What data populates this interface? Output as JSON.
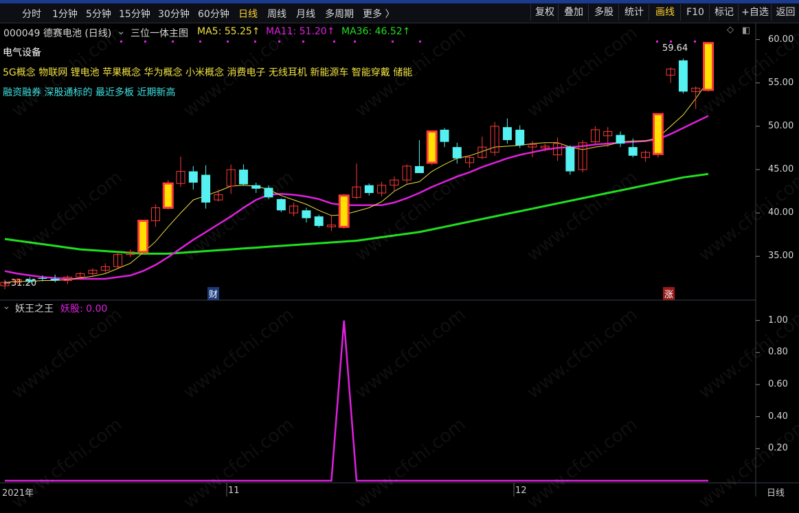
{
  "toolbar": {
    "periods": [
      "分时",
      "1分钟",
      "5分钟",
      "15分钟",
      "30分钟",
      "60分钟",
      "日线",
      "周线",
      "月线",
      "多周期",
      "更多 〉"
    ],
    "active_period": "日线",
    "right_buttons": [
      "复权",
      "叠加",
      "多股",
      "统计",
      "画线",
      "F10",
      "标记",
      "+自选",
      "返回"
    ],
    "active_right": "画线"
  },
  "stock": {
    "code_name": "000049 德赛电池 (日线)",
    "indicator_name": "三位一体主图",
    "ma5_label": "MA5: 55.25↑",
    "ma11_label": "MA11: 51.20↑",
    "ma36_label": "MA36: 46.52↑",
    "industry": "电气设备",
    "concepts": "5G概念 物联网 锂电池 苹果概念 华为概念 小米概念 消费电子 无线耳机 新能源车 智能穿戴 储能",
    "tags": "融资融券 深股通标的 最近多板 近期新高",
    "high_label": "59.64",
    "low_label": "←31.20",
    "marker_cai": "财",
    "marker_zhang": "涨"
  },
  "sub_indicator": {
    "name": "妖王之王",
    "series_label": "妖股: 0.00"
  },
  "colors": {
    "up": "#ff3a3a",
    "down": "#55f0f0",
    "ma5": "#f0e040",
    "ma11": "#e020e0",
    "ma36": "#20e020",
    "limit_up_fill": "#ffe000",
    "yaogu": "#e020e0"
  },
  "chart_data": [
    {
      "type": "candlestick",
      "title": "000049 德赛电池 (日线)",
      "ylim": [
        30.5,
        61
      ],
      "y_ticks": [
        "60.00",
        "55.00",
        "50.00",
        "45.00",
        "40.00",
        "35.00"
      ],
      "x_labels": [
        "2021年",
        "11",
        "12",
        "日线"
      ],
      "candles": [
        {
          "o": 31.6,
          "h": 32.3,
          "l": 31.2,
          "c": 32.0
        },
        {
          "o": 32.0,
          "h": 32.5,
          "l": 31.8,
          "c": 32.3
        },
        {
          "o": 32.3,
          "h": 32.6,
          "l": 31.9,
          "c": 32.1
        },
        {
          "o": 32.5,
          "h": 32.8,
          "l": 32.1,
          "c": 32.4
        },
        {
          "o": 32.4,
          "h": 32.9,
          "l": 32.0,
          "c": 32.2
        },
        {
          "o": 32.2,
          "h": 32.8,
          "l": 31.8,
          "c": 32.6
        },
        {
          "o": 32.6,
          "h": 33.2,
          "l": 32.3,
          "c": 33.0
        },
        {
          "o": 33.0,
          "h": 33.6,
          "l": 32.7,
          "c": 33.4
        },
        {
          "o": 33.4,
          "h": 34.2,
          "l": 33.1,
          "c": 33.8
        },
        {
          "o": 33.8,
          "h": 35.5,
          "l": 33.6,
          "c": 35.2
        },
        {
          "o": 35.2,
          "h": 35.8,
          "l": 34.9,
          "c": 35.5
        },
        {
          "o": 35.5,
          "h": 39.2,
          "l": 35.3,
          "c": 39.1,
          "limit": true
        },
        {
          "o": 39.1,
          "h": 41.0,
          "l": 38.4,
          "c": 40.6
        },
        {
          "o": 40.6,
          "h": 43.8,
          "l": 40.4,
          "c": 43.4,
          "limit": true
        },
        {
          "o": 43.4,
          "h": 46.5,
          "l": 43.0,
          "c": 44.8
        },
        {
          "o": 44.8,
          "h": 45.4,
          "l": 42.7,
          "c": 43.5
        },
        {
          "o": 44.4,
          "h": 45.5,
          "l": 40.5,
          "c": 41.2
        },
        {
          "o": 41.5,
          "h": 42.7,
          "l": 41.3,
          "c": 42.1
        },
        {
          "o": 43.1,
          "h": 45.6,
          "l": 42.2,
          "c": 45.0
        },
        {
          "o": 45.0,
          "h": 45.6,
          "l": 43.2,
          "c": 43.3
        },
        {
          "o": 43.2,
          "h": 43.5,
          "l": 42.3,
          "c": 42.8
        },
        {
          "o": 42.9,
          "h": 43.2,
          "l": 41.6,
          "c": 41.8
        },
        {
          "o": 41.6,
          "h": 41.7,
          "l": 40.1,
          "c": 40.3
        },
        {
          "o": 40.0,
          "h": 41.2,
          "l": 39.6,
          "c": 40.8
        },
        {
          "o": 40.3,
          "h": 40.6,
          "l": 38.9,
          "c": 39.4
        },
        {
          "o": 39.6,
          "h": 39.8,
          "l": 38.3,
          "c": 38.5
        },
        {
          "o": 38.4,
          "h": 39.8,
          "l": 37.9,
          "c": 38.6
        },
        {
          "o": 38.4,
          "h": 42.2,
          "l": 38.2,
          "c": 42.0,
          "limit": true
        },
        {
          "o": 41.8,
          "h": 45.7,
          "l": 41.6,
          "c": 43.0
        },
        {
          "o": 43.2,
          "h": 43.4,
          "l": 42.0,
          "c": 42.3
        },
        {
          "o": 42.3,
          "h": 43.6,
          "l": 41.9,
          "c": 43.2
        },
        {
          "o": 43.2,
          "h": 44.2,
          "l": 42.5,
          "c": 43.8
        },
        {
          "o": 43.8,
          "h": 45.6,
          "l": 43.4,
          "c": 45.4
        },
        {
          "o": 45.4,
          "h": 48.4,
          "l": 45.0,
          "c": 44.6
        },
        {
          "o": 45.8,
          "h": 49.5,
          "l": 45.5,
          "c": 49.4,
          "limit": true
        },
        {
          "o": 49.6,
          "h": 49.8,
          "l": 47.6,
          "c": 48.2
        },
        {
          "o": 47.6,
          "h": 48.1,
          "l": 45.7,
          "c": 46.3
        },
        {
          "o": 45.8,
          "h": 46.6,
          "l": 45.2,
          "c": 46.4
        },
        {
          "o": 46.4,
          "h": 48.8,
          "l": 46.2,
          "c": 47.6
        },
        {
          "o": 47.0,
          "h": 50.5,
          "l": 46.6,
          "c": 50.0
        },
        {
          "o": 49.9,
          "h": 50.9,
          "l": 48.0,
          "c": 48.4
        },
        {
          "o": 49.6,
          "h": 50.1,
          "l": 47.5,
          "c": 47.8
        },
        {
          "o": 47.6,
          "h": 48.3,
          "l": 46.4,
          "c": 47.9
        },
        {
          "o": 47.5,
          "h": 48.0,
          "l": 47.1,
          "c": 47.7
        },
        {
          "o": 46.7,
          "h": 48.7,
          "l": 46.0,
          "c": 48.0
        },
        {
          "o": 47.6,
          "h": 47.8,
          "l": 44.4,
          "c": 44.8
        },
        {
          "o": 45.0,
          "h": 48.4,
          "l": 44.7,
          "c": 48.1
        },
        {
          "o": 48.2,
          "h": 50.0,
          "l": 48.0,
          "c": 49.6
        },
        {
          "o": 48.9,
          "h": 49.9,
          "l": 47.6,
          "c": 49.4
        },
        {
          "o": 49.0,
          "h": 49.4,
          "l": 47.6,
          "c": 48.0
        },
        {
          "o": 47.6,
          "h": 48.6,
          "l": 46.4,
          "c": 46.6
        },
        {
          "o": 46.4,
          "h": 47.2,
          "l": 45.9,
          "c": 47.0
        },
        {
          "o": 46.8,
          "h": 51.4,
          "l": 46.4,
          "c": 51.4,
          "limit": true
        },
        {
          "o": 55.9,
          "h": 56.8,
          "l": 55.0,
          "c": 56.6
        },
        {
          "o": 57.6,
          "h": 57.8,
          "l": 53.8,
          "c": 54.0
        },
        {
          "o": 54.0,
          "h": 54.6,
          "l": 52.0,
          "c": 54.4
        },
        {
          "o": 54.2,
          "h": 59.7,
          "l": 54.0,
          "c": 59.6,
          "limit": true
        }
      ],
      "ma5": [
        32.0,
        32.1,
        32.1,
        32.2,
        32.2,
        32.3,
        32.5,
        32.7,
        33.0,
        33.6,
        34.2,
        35.4,
        36.7,
        38.4,
        40.0,
        41.5,
        42.0,
        42.5,
        43.1,
        43.2,
        43.1,
        42.7,
        42.0,
        41.5,
        41.0,
        40.3,
        39.7,
        39.8,
        40.2,
        40.6,
        41.3,
        42.5,
        43.3,
        43.6,
        44.8,
        45.6,
        46.3,
        46.6,
        47.1,
        47.6,
        47.7,
        47.8,
        48.0,
        48.1,
        48.1,
        47.6,
        47.3,
        47.6,
        47.8,
        48.2,
        48.3,
        48.3,
        48.7,
        50.0,
        51.3,
        53.2,
        55.25
      ],
      "ma11": [
        33.3,
        33.0,
        32.8,
        32.6,
        32.5,
        32.4,
        32.4,
        32.4,
        32.4,
        32.6,
        32.8,
        33.3,
        34.0,
        34.9,
        35.9,
        36.9,
        37.8,
        38.7,
        39.6,
        40.6,
        41.5,
        42.1,
        42.2,
        42.1,
        41.9,
        41.6,
        41.1,
        40.9,
        40.9,
        40.9,
        40.9,
        41.2,
        41.7,
        42.3,
        43.0,
        43.6,
        44.2,
        44.7,
        45.3,
        45.8,
        46.3,
        46.7,
        47.0,
        47.3,
        47.5,
        47.6,
        47.7,
        47.9,
        48.0,
        48.1,
        48.2,
        48.3,
        48.5,
        49.1,
        49.8,
        50.5,
        51.2
      ],
      "ma36": [
        37.0,
        36.8,
        36.6,
        36.4,
        36.2,
        36.0,
        35.8,
        35.7,
        35.6,
        35.5,
        35.4,
        35.3,
        35.3,
        35.3,
        35.4,
        35.5,
        35.6,
        35.7,
        35.8,
        35.9,
        36.0,
        36.1,
        36.2,
        36.3,
        36.4,
        36.5,
        36.6,
        36.7,
        36.8,
        37.0,
        37.2,
        37.4,
        37.6,
        37.8,
        38.1,
        38.4,
        38.7,
        39.0,
        39.3,
        39.6,
        39.9,
        40.2,
        40.5,
        40.8,
        41.1,
        41.4,
        41.7,
        42.0,
        42.3,
        42.6,
        42.9,
        43.2,
        43.5,
        43.8,
        44.1,
        44.3,
        44.5
      ]
    },
    {
      "type": "line",
      "title": "妖王之王",
      "series": [
        {
          "name": "妖股",
          "values": [
            0,
            0,
            0,
            0,
            0,
            0,
            0,
            0,
            0,
            0,
            0,
            0,
            0,
            0,
            0,
            0,
            0,
            0,
            0,
            0,
            0,
            0,
            0,
            0,
            0,
            0,
            0,
            1,
            0,
            0,
            0,
            0,
            0,
            0,
            0,
            0,
            0,
            0,
            0,
            0,
            0,
            0,
            0,
            0,
            0,
            0,
            0,
            0,
            0,
            0,
            0,
            0,
            0,
            0,
            0,
            0,
            0
          ]
        }
      ],
      "ylim": [
        0,
        1.05
      ],
      "y_ticks": [
        "1.00",
        "0.80",
        "0.60",
        "0.40",
        "0.20"
      ]
    }
  ]
}
